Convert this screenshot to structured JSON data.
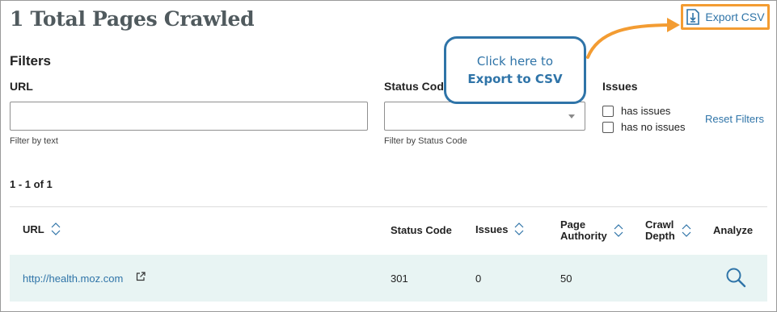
{
  "page": {
    "title": "1 Total Pages Crawled",
    "export_label": "Export CSV"
  },
  "callout": {
    "line1": "Click here to",
    "line2": "Export to CSV"
  },
  "filters": {
    "heading": "Filters",
    "url_label": "URL",
    "url_value": "",
    "url_help": "Filter by text",
    "status_label": "Status Code",
    "status_value": "",
    "status_help": "Filter by Status Code",
    "issues_label": "Issues",
    "issue_options": [
      "has issues",
      "has no issues"
    ],
    "reset_label": "Reset Filters"
  },
  "pagination": "1 - 1 of 1",
  "table": {
    "headers": {
      "url": "URL",
      "status_code": "Status Code",
      "issues": "Issues",
      "page_authority_1": "Page",
      "page_authority_2": "Authority",
      "crawl_depth_1": "Crawl",
      "crawl_depth_2": "Depth",
      "analyze": "Analyze"
    },
    "rows": [
      {
        "url": "http://health.moz.com",
        "status_code": "301",
        "issues": "0",
        "page_authority": "50"
      }
    ]
  },
  "colors": {
    "link": "#2f74a8",
    "highlight": "#f39c32",
    "row_background": "#e8f4f3",
    "title": "#505a5e"
  },
  "icons": [
    "download-file-icon",
    "sort-icon",
    "external-link-icon",
    "search-icon",
    "chevron-down-icon"
  ]
}
